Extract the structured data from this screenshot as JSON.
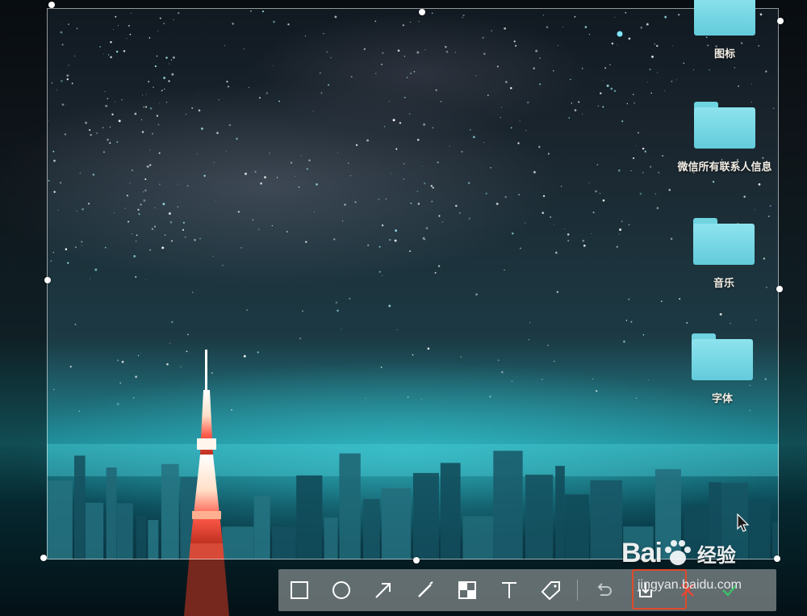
{
  "desktop": {
    "items": [
      {
        "label": "图标"
      },
      {
        "label": "微信所有联系人信息"
      },
      {
        "label": "音乐"
      },
      {
        "label": "字体"
      }
    ]
  },
  "toolbar": {
    "tools": [
      {
        "name": "rectangle-tool",
        "icon": "rectangle-icon"
      },
      {
        "name": "ellipse-tool",
        "icon": "circle-icon"
      },
      {
        "name": "arrow-tool",
        "icon": "arrow-icon"
      },
      {
        "name": "pen-tool",
        "icon": "pen-icon"
      },
      {
        "name": "mosaic-tool",
        "icon": "mosaic-icon"
      },
      {
        "name": "text-tool",
        "icon": "text-icon"
      },
      {
        "name": "tag-tool",
        "icon": "tag-icon"
      },
      {
        "name": "undo-tool",
        "icon": "undo-icon"
      },
      {
        "name": "save-tool",
        "icon": "download-icon"
      },
      {
        "name": "cancel-tool",
        "icon": "close-icon"
      },
      {
        "name": "confirm-tool",
        "icon": "check-icon"
      }
    ],
    "highlight_color": "#e04a2a",
    "cancel_color": "#e8443a",
    "confirm_color": "#3cc06a"
  },
  "watermark": {
    "logo": "Bai",
    "logo_cn": "经验",
    "url": "jingyan.baidu.com"
  },
  "colors": {
    "folder": "#63cbdb",
    "label": "#f3efe6"
  }
}
